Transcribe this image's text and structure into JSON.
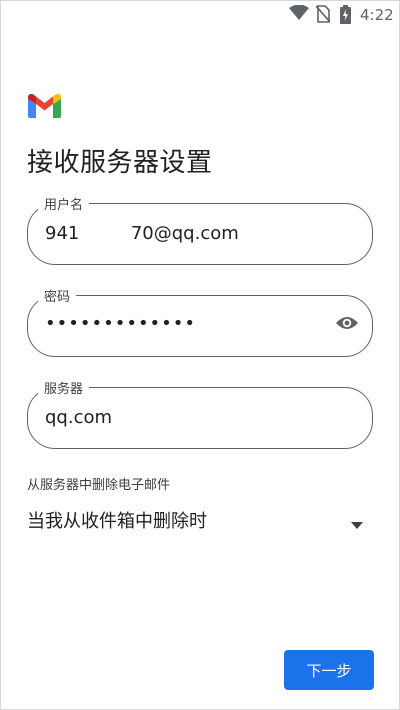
{
  "status_bar": {
    "time": "4:22",
    "icons": [
      "wifi-icon",
      "no-sim-icon",
      "battery-charging-icon"
    ]
  },
  "app": {
    "logo": "gmail-logo"
  },
  "page": {
    "title": "接收服务器设置"
  },
  "form": {
    "username": {
      "label": "用户名",
      "value": "941         70@qq.com"
    },
    "password": {
      "label": "密码",
      "value": "•••••••••••••",
      "toggle_icon": "eye-icon"
    },
    "server": {
      "label": "服务器",
      "value": "qq.com"
    },
    "delete_setting": {
      "label": "从服务器中删除电子邮件",
      "selected": "当我从收件箱中删除时"
    }
  },
  "actions": {
    "next_label": "下一步"
  },
  "colors": {
    "primary": "#1a73e8",
    "outline": "#5f6368",
    "gmail_red": "#ea4335",
    "gmail_blue": "#4285f4",
    "gmail_green": "#34a853",
    "gmail_yellow": "#fbbc04"
  }
}
